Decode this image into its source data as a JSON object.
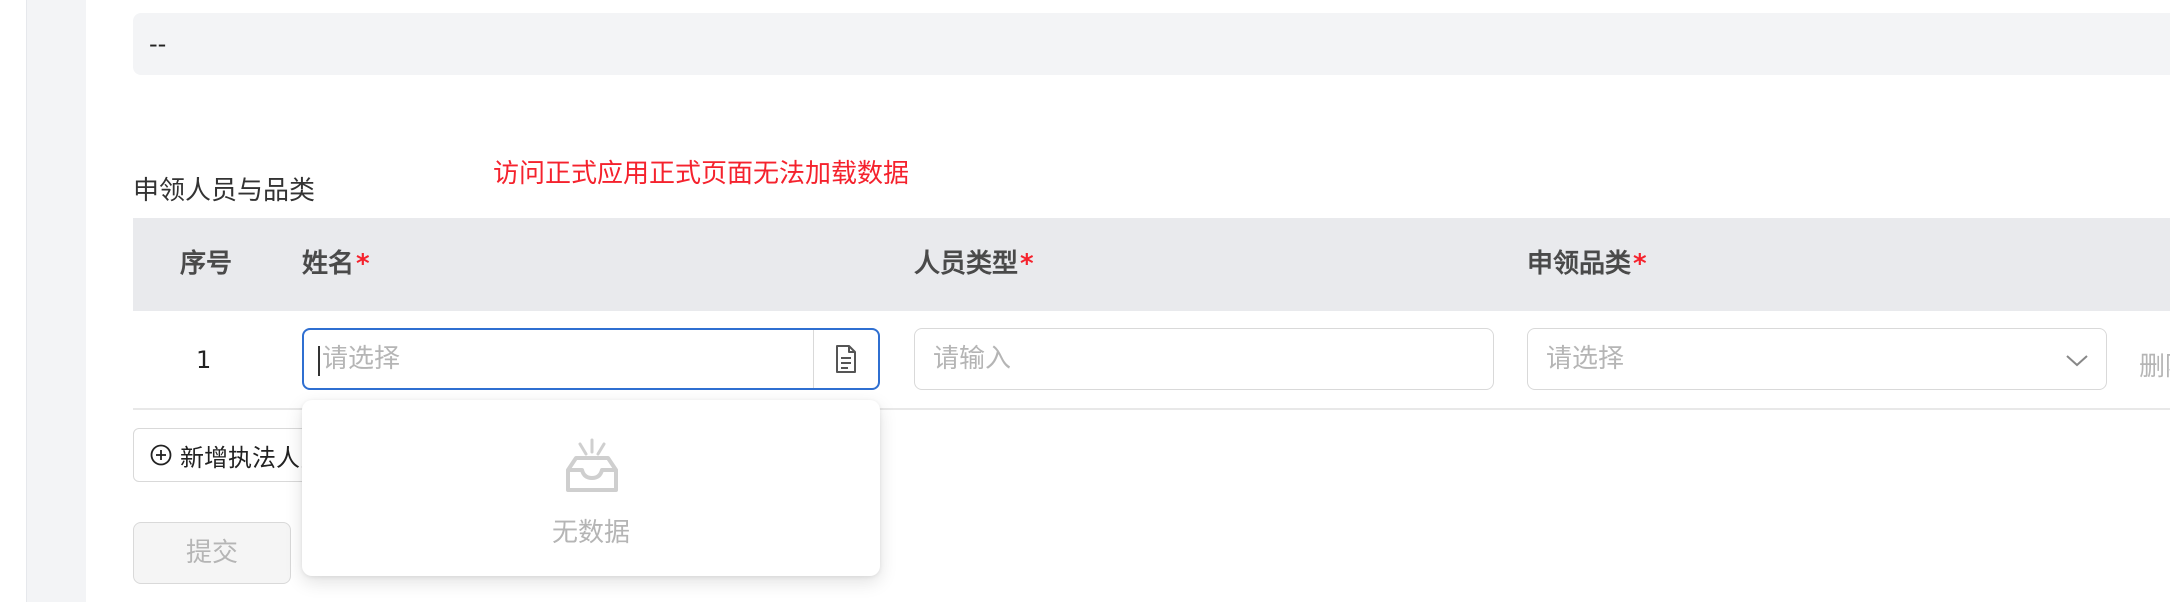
{
  "display_value": "--",
  "section_title": "申领人员与品类",
  "error_note": "访问正式应用正式页面无法加载数据",
  "table": {
    "columns": [
      {
        "label": "序号",
        "required": false
      },
      {
        "label": "姓名",
        "required": true
      },
      {
        "label": "人员类型",
        "required": true
      },
      {
        "label": "申领品类",
        "required": true
      }
    ],
    "required_mark": "*",
    "rows": [
      {
        "index": "1",
        "name_placeholder": "请选择",
        "type_placeholder": "请输入",
        "category_placeholder": "请选择",
        "delete_label": "删除"
      }
    ]
  },
  "add_button_label": "新增执法人员",
  "submit_button_label": "提交",
  "dropdown": {
    "empty_text": "无数据"
  },
  "icons": {
    "name_addon": "document-icon",
    "select_arrow": "chevron-down-icon",
    "add": "plus-circle-icon",
    "empty": "empty-inbox-icon"
  },
  "colors": {
    "accent": "#2f6fd1",
    "required": "#f5222d",
    "error_text": "#f5222d",
    "placeholder": "#b5b5b5"
  }
}
